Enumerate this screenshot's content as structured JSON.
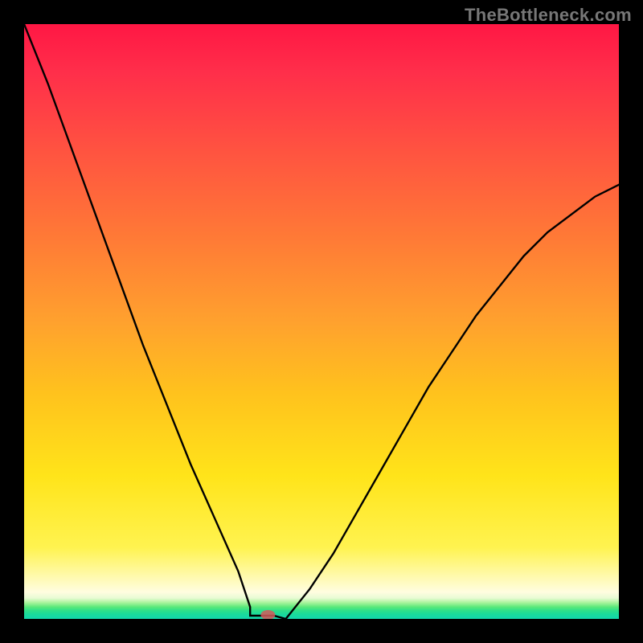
{
  "watermark": "TheBottleneck.com",
  "colors": {
    "background": "#000000",
    "curve": "#000000",
    "gradient_top": "#ff1744",
    "gradient_bottom": "#14d7ad",
    "marker": "rgba(210,90,90,0.85)"
  },
  "chart_data": {
    "type": "line",
    "title": "",
    "xlabel": "",
    "ylabel": "",
    "xlim": [
      0,
      1
    ],
    "ylim": [
      0,
      1
    ],
    "notes": "V-shaped bottleneck curve over rainbow gradient; y = |x - 0.4| scaled, minimum at x≈0.4",
    "minimum": {
      "x": 0.4,
      "flat_width": 0.04,
      "value": 0
    },
    "series": [
      {
        "name": "bottleneck",
        "x": [
          0.0,
          0.04,
          0.08,
          0.12,
          0.16,
          0.2,
          0.24,
          0.28,
          0.32,
          0.36,
          0.38,
          0.4,
          0.44,
          0.48,
          0.52,
          0.56,
          0.6,
          0.64,
          0.68,
          0.72,
          0.76,
          0.8,
          0.84,
          0.88,
          0.92,
          0.96,
          1.0
        ],
        "y": [
          1.0,
          0.9,
          0.79,
          0.68,
          0.57,
          0.46,
          0.36,
          0.26,
          0.17,
          0.08,
          0.02,
          0.0,
          0.0,
          0.05,
          0.11,
          0.18,
          0.25,
          0.32,
          0.39,
          0.45,
          0.51,
          0.56,
          0.61,
          0.65,
          0.68,
          0.71,
          0.73
        ]
      }
    ]
  }
}
